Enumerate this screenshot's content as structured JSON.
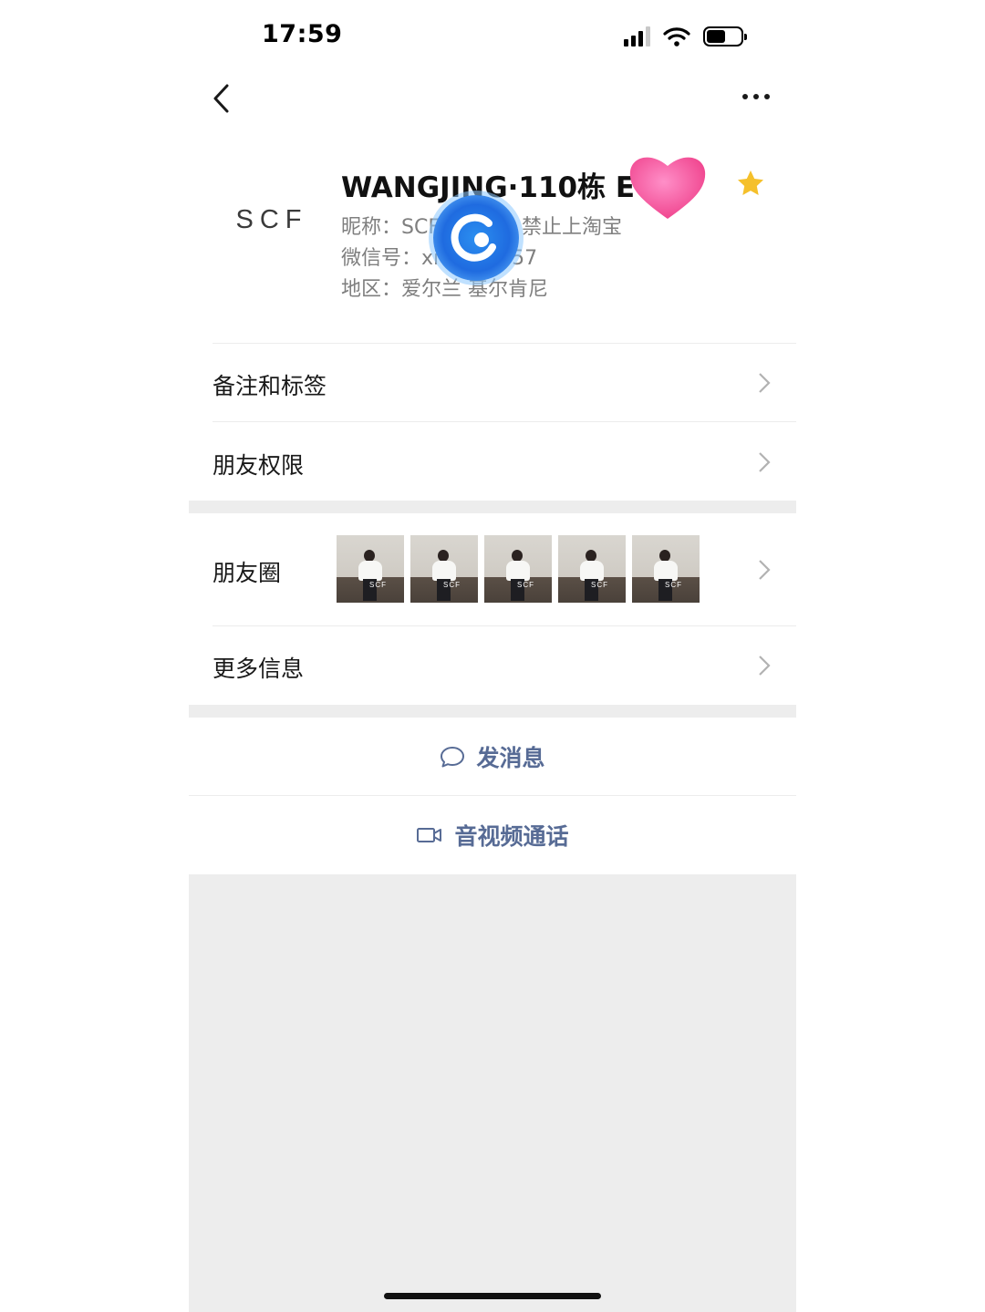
{
  "status_bar": {
    "time": "17:59"
  },
  "profile": {
    "avatar_text": "SCF",
    "name": "WANGJING·110栋 E",
    "nickname": "昵称：SCF",
    "nickname_suffix": "禁止上淘宝",
    "wechat_id": "微信号：xi",
    "wechat_id_suffix": "57",
    "region": "地区：爱尔兰 基尔肯尼",
    "starred": true
  },
  "menu": {
    "notes_tags": "备注和标签",
    "friend_permissions": "朋友权限",
    "moments": "朋友圈",
    "more_info": "更多信息"
  },
  "moments_thumbnails": [
    {
      "label": "SCF"
    },
    {
      "label": "SCF"
    },
    {
      "label": "SCF"
    },
    {
      "label": "SCF"
    },
    {
      "label": "SCF"
    }
  ],
  "actions": {
    "send_message": "发消息",
    "av_call": "音视频通话"
  },
  "colors": {
    "link_blue": "#576b95",
    "star_yellow": "#f5c02b",
    "band_gray": "#ededed"
  },
  "icons": [
    "back-icon",
    "more-icon",
    "star-icon",
    "chevron-right-icon",
    "chat-bubble-icon",
    "video-camera-icon",
    "signal-icon",
    "wifi-icon",
    "battery-icon"
  ]
}
